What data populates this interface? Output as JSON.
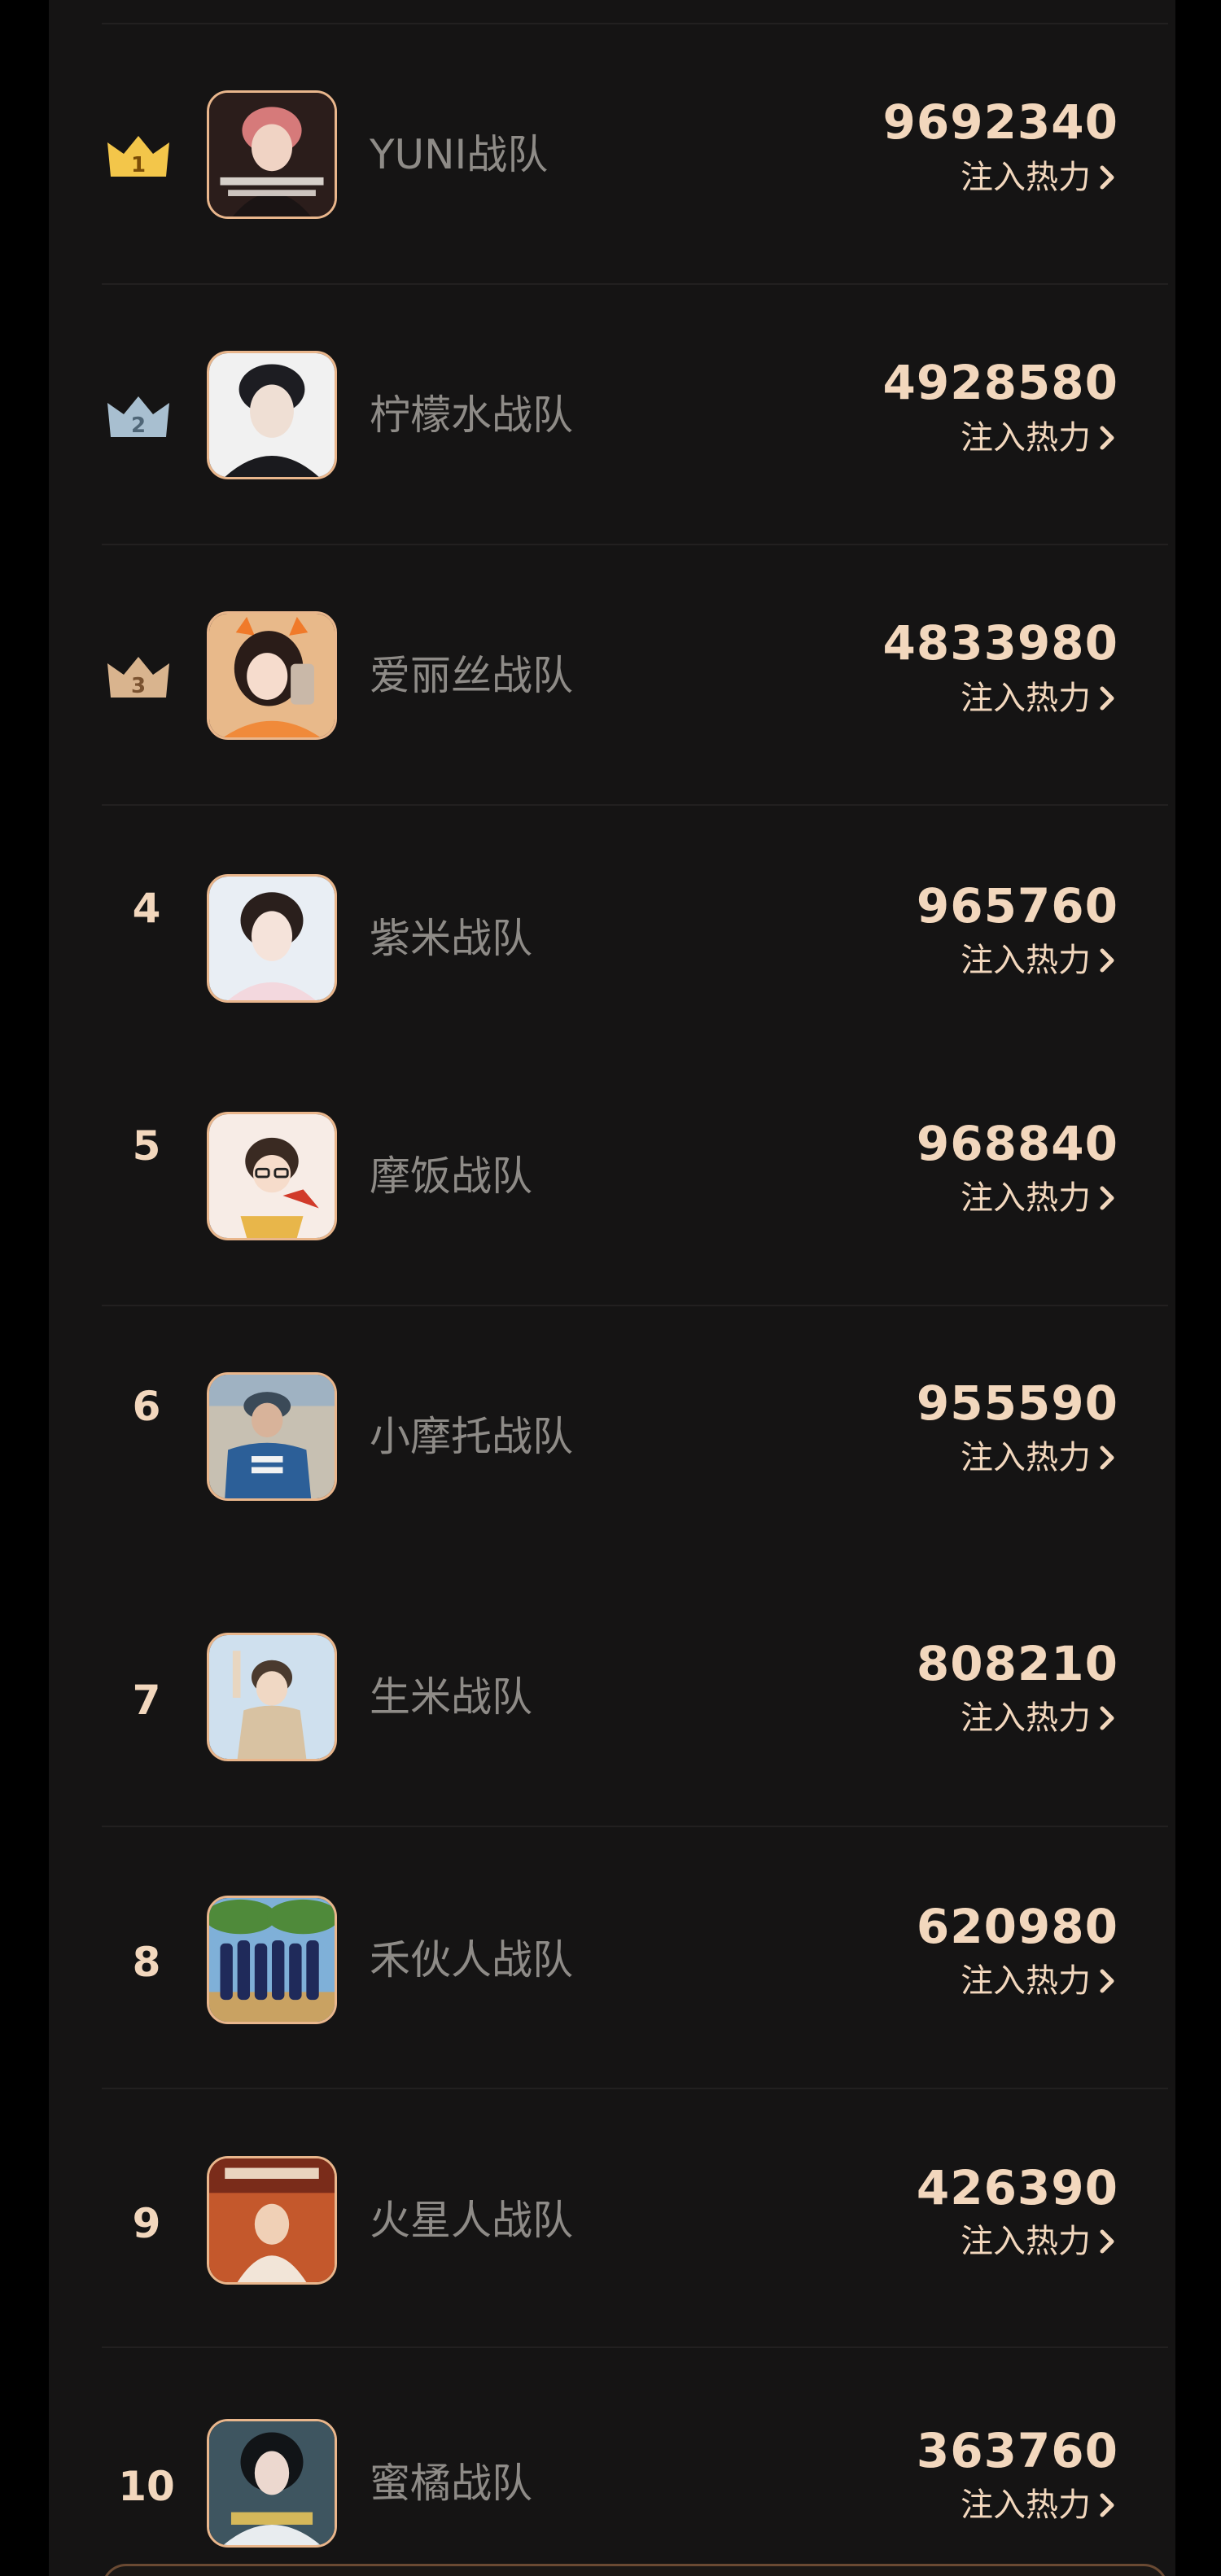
{
  "ranking": {
    "inject_label": "注入热力",
    "colors": {
      "accent": "#f2d7bd",
      "name": "#8e8b87",
      "border": "#e9b68c",
      "gold": "#f3c64a",
      "silver": "#a8bfd0",
      "bronze": "#d9b48e"
    },
    "rows": [
      {
        "rank": "1",
        "badge": "gold-crown",
        "name": "YUNI战队",
        "score": "9692340"
      },
      {
        "rank": "2",
        "badge": "silver-crown",
        "name": "柠檬水战队",
        "score": "4928580"
      },
      {
        "rank": "3",
        "badge": "bronze-crown",
        "name": "爱丽丝战队",
        "score": "4833980"
      },
      {
        "rank": "4",
        "badge": "",
        "name": "紫米战队",
        "score": "965760"
      },
      {
        "rank": "5",
        "badge": "",
        "name": "摩饭战队",
        "score": "968840"
      },
      {
        "rank": "6",
        "badge": "",
        "name": "小摩托战队",
        "score": "955590"
      },
      {
        "rank": "7",
        "badge": "",
        "name": "生米战队",
        "score": "808210"
      },
      {
        "rank": "8",
        "badge": "",
        "name": "禾伙人战队",
        "score": "620980"
      },
      {
        "rank": "9",
        "badge": "",
        "name": "火星人战队",
        "score": "426390"
      },
      {
        "rank": "10",
        "badge": "",
        "name": "蜜橘战队",
        "score": "363760"
      }
    ]
  }
}
